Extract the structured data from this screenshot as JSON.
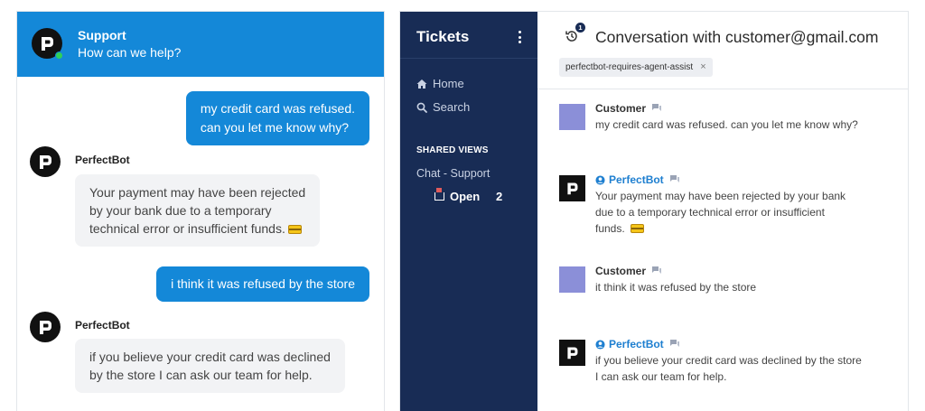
{
  "widget": {
    "title": "Support",
    "subtitle": "How can we help?",
    "bot_name": "PerfectBot",
    "messages": {
      "user1": "my credit card was refused.\ncan you let me know why?",
      "bot1": "Your payment may have been rejected\nby your bank due to a temporary\ntechnical error or insufficient funds.",
      "user2": "i think it was refused by the store",
      "bot2": "if you believe your credit card was declined\nby the store  I can ask our team for help."
    }
  },
  "sidebar": {
    "title": "Tickets",
    "nav": [
      "Home",
      "Search"
    ],
    "views_heading": "SHARED VIEWS",
    "view_group": "Chat - Support",
    "view_open_label": "Open",
    "view_open_count": "2"
  },
  "conversation": {
    "title": "Conversation with customer@gmail.com",
    "history_badge": "1",
    "tag": "perfectbot-requires-agent-assist",
    "tag_remove": "×",
    "messages": [
      {
        "author": "Customer",
        "text": "my credit card was refused. can you let me know why?"
      },
      {
        "author": "PerfectBot",
        "text": "Your payment may have been rejected by your bank\ndue to a temporary technical error or insufficient\nfunds."
      },
      {
        "author": "Customer",
        "text": "it think it was refused by the store"
      },
      {
        "author": "PerfectBot",
        "text": "if you believe your credit card was declined by the store\nI can ask our team for help."
      }
    ]
  },
  "colors": {
    "accent": "#1488d8",
    "sidebar_bg": "#182c55",
    "customer_avatar": "#8b8fd8"
  }
}
